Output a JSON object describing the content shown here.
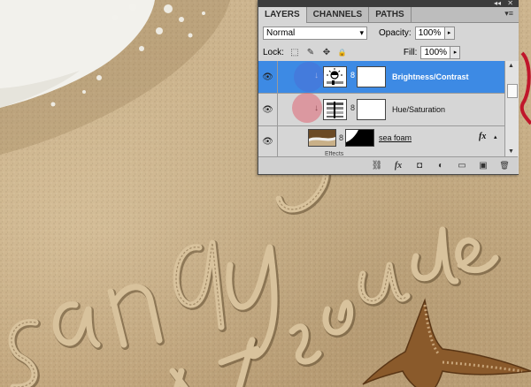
{
  "canvas": {
    "handwriting_primary": "SandyDo",
    "handwriting_secondary": "PSddude",
    "colors": {
      "sand": "#c7ad85",
      "foam": "#f4f3ee",
      "starfish": "#8a5a2b"
    }
  },
  "panel": {
    "collapse_glyph": "◂◂",
    "close_glyph": "✕",
    "tabs": [
      {
        "label": "LAYERS",
        "active": true
      },
      {
        "label": "CHANNELS",
        "active": false
      },
      {
        "label": "PATHS",
        "active": false
      }
    ],
    "menu_icon": "panel-menu-icon",
    "menu_glyph": "▾≡",
    "blend_mode": "Normal",
    "dropdown_glyph": "▾",
    "step_glyph": "▸",
    "opacity_label": "Opacity:",
    "opacity_value": "100%",
    "lock_label": "Lock:",
    "fill_label": "Fill:",
    "fill_value": "100%",
    "lock_icons": [
      {
        "name": "lock-transparent-icon",
        "glyph": "⬚"
      },
      {
        "name": "lock-image-icon",
        "glyph": "✎"
      },
      {
        "name": "lock-position-icon",
        "glyph": "✥"
      },
      {
        "name": "lock-all-icon",
        "glyph": "🔒"
      }
    ],
    "layers": [
      {
        "name": "Brightness/Contrast",
        "type": "adjustment",
        "selected": true,
        "visible": true
      },
      {
        "name": "Hue/Saturation",
        "type": "adjustment",
        "selected": false,
        "visible": true
      },
      {
        "name": "sea foam",
        "type": "pixel",
        "selected": false,
        "visible": true,
        "fx": "fx"
      },
      {
        "name": "Effects",
        "type": "effects",
        "selected": false,
        "visible": true
      }
    ],
    "eye_glyph": "👁",
    "chain_glyph": "8",
    "clip_arrow_glyph": "↓",
    "fx_expand_glyph": "▴",
    "scroll_up_glyph": "▲",
    "scroll_down_glyph": "▼",
    "bottom_icons": [
      {
        "name": "link-layers-icon",
        "glyph": "⛓"
      },
      {
        "name": "add-style-icon",
        "glyph": "fx"
      },
      {
        "name": "add-mask-icon",
        "glyph": "◘"
      },
      {
        "name": "adjustment-layer-icon",
        "glyph": "◐"
      },
      {
        "name": "new-group-icon",
        "glyph": "▭"
      },
      {
        "name": "new-layer-icon",
        "glyph": "▣"
      },
      {
        "name": "delete-layer-icon",
        "glyph": "🗑"
      }
    ],
    "colors": {
      "selection": "#3d8ae4",
      "panel_bg": "#d6d6d6",
      "highlight_blue": "#4a6fd6",
      "highlight_red": "#e05a6a"
    }
  }
}
